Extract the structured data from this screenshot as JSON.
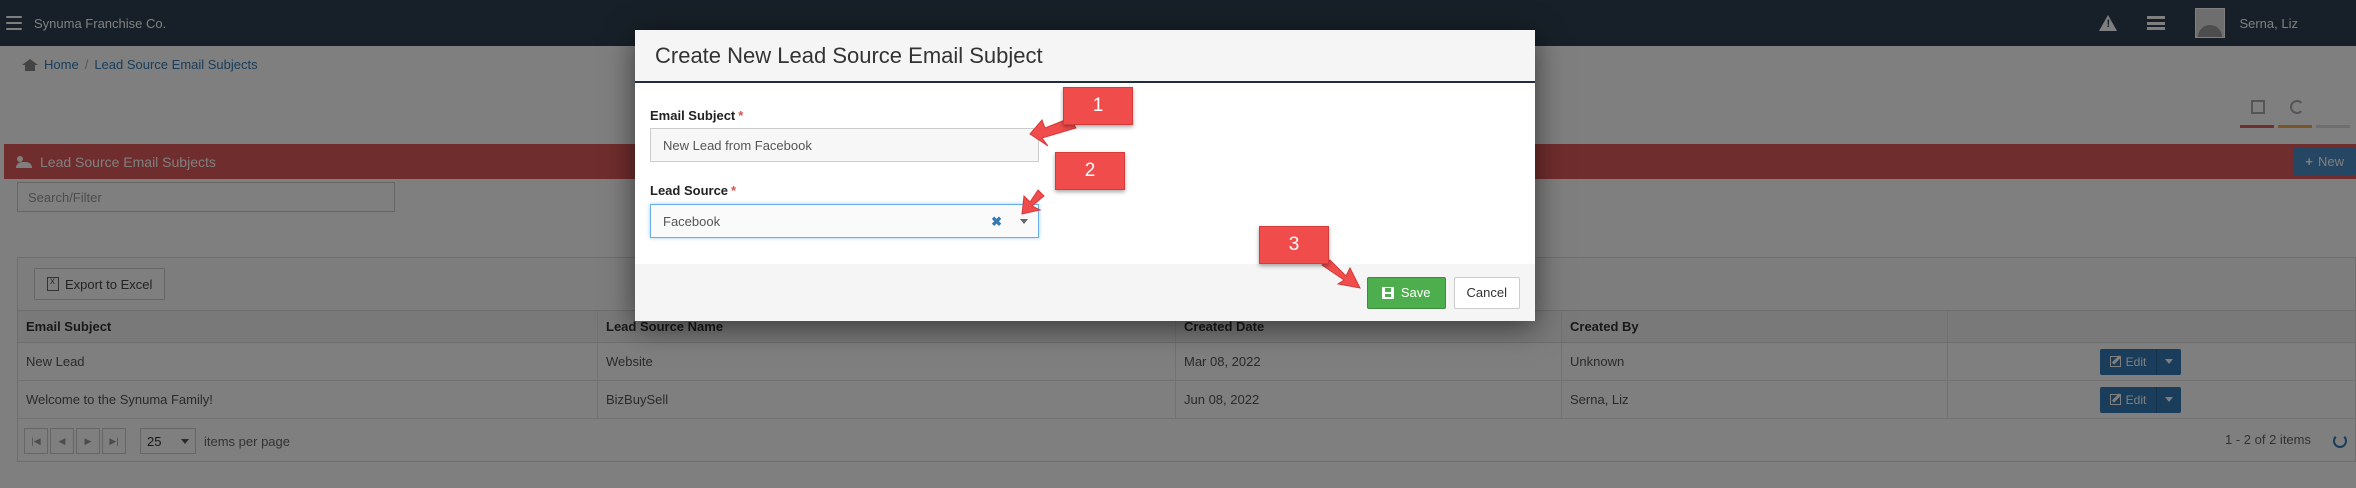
{
  "app": {
    "brand": "Synuma Franchise Co.",
    "user_name": "Serna, Liz"
  },
  "breadcrumb": {
    "home": "Home",
    "separator": "/",
    "current": "Lead Source Email Subjects"
  },
  "panel": {
    "title": "Lead Source Email Subjects",
    "new_label": "New",
    "search_placeholder": "Search/Filter",
    "accent_color": "#e05a5a"
  },
  "grid": {
    "export_label": "Export to Excel",
    "columns": [
      "Email Subject",
      "Lead Source Name",
      "Created Date",
      "Created By",
      ""
    ],
    "rows": [
      {
        "subject": "New Lead",
        "source": "Website",
        "date": "Mar 08, 2022",
        "created_by": "Unknown",
        "action": "Edit"
      },
      {
        "subject": "Welcome to the Synuma Family!",
        "source": "BizBuySell",
        "date": "Jun 08, 2022",
        "created_by": "Serna, Liz",
        "action": "Edit"
      }
    ],
    "pager": {
      "page_size": "25",
      "items_per_page": "items per page",
      "info": "1 - 2 of 2 items"
    }
  },
  "modal": {
    "title": "Create New Lead Source Email Subject",
    "email_subject_label": "Email Subject",
    "email_subject_value": "New Lead from Facebook",
    "lead_source_label": "Lead Source",
    "lead_source_value": "Facebook",
    "required_marker": "*",
    "save_label": "Save",
    "cancel_label": "Cancel"
  },
  "callouts": [
    "1",
    "2",
    "3"
  ],
  "colors": {
    "topbar": "#2f4050",
    "save": "#4cae4c",
    "callout": "#f04c4c",
    "edit": "#337ab7"
  }
}
